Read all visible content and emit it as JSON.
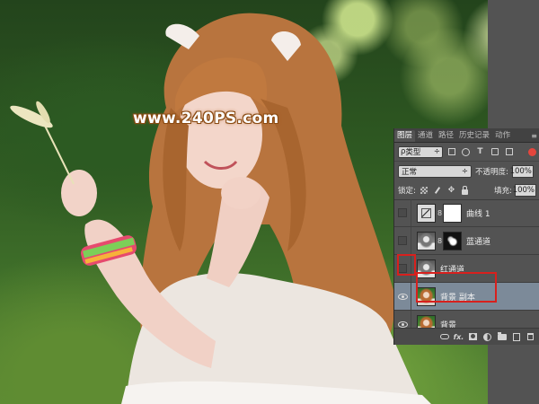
{
  "watermark": "www.240PS.com",
  "panel": {
    "tabs": [
      {
        "label": "图层",
        "active": true
      },
      {
        "label": "通道",
        "active": false
      },
      {
        "label": "路径",
        "active": false
      },
      {
        "label": "历史记录",
        "active": false
      },
      {
        "label": "动作",
        "active": false
      }
    ],
    "menu_glyph": "≡",
    "filter": {
      "search_glyph": "ρ",
      "kind": "类型",
      "arrow": "÷"
    },
    "blend": {
      "mode": "正常",
      "arrow": "÷",
      "opacity_label": "不透明度:",
      "opacity_value": "100%"
    },
    "lock": {
      "label": "锁定:",
      "move_glyph": "✥",
      "fill_label": "填充:",
      "fill_value": "100%"
    },
    "layers": [
      {
        "name": "曲线 1",
        "visible": false,
        "selected": false,
        "thumb": "curves",
        "mask": "white"
      },
      {
        "name": "蓝通道",
        "visible": false,
        "selected": false,
        "thumb": "bw",
        "mask": "dark"
      },
      {
        "name": "红通道",
        "visible": false,
        "selected": false,
        "thumb": "bw",
        "mask": null
      },
      {
        "name": "背景 副本",
        "visible": true,
        "selected": true,
        "thumb": "photo",
        "mask": null
      },
      {
        "name": "背景",
        "visible": true,
        "selected": false,
        "thumb": "photo",
        "mask": null
      }
    ],
    "footer_glyphs": {
      "fx": "fx."
    },
    "highlight_color": "#d8201d",
    "selection_color": "#7c8a99"
  }
}
